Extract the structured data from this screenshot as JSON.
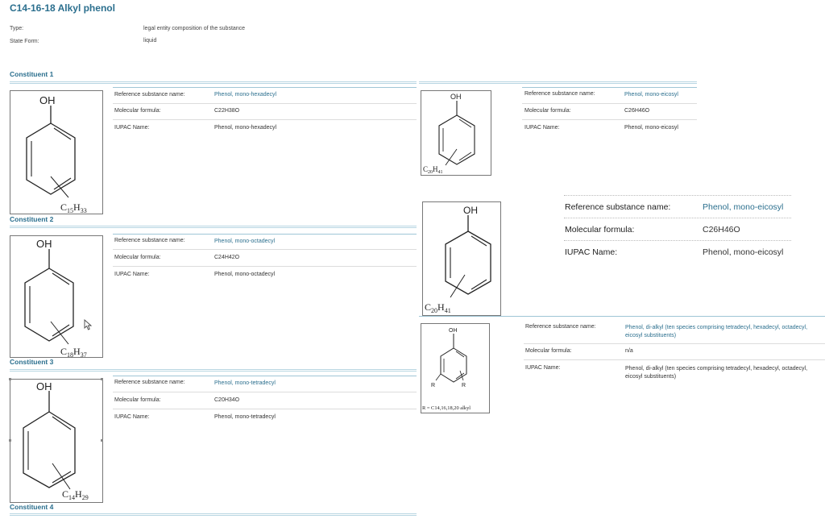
{
  "title": "C14-16-18 Alkyl phenol",
  "meta": {
    "type_label": "Type:",
    "type_value": "legal entity composition of the substance",
    "state_label": "State Form:",
    "state_value": "liquid"
  },
  "constituent_headings": [
    "Constituent 1",
    "Constituent 2",
    "Constituent 3",
    "Constituent 4"
  ],
  "labels": {
    "ref": "Reference substance name:",
    "formula": "Molecular formula:",
    "iupac": "IUPAC Name:"
  },
  "constituents": [
    {
      "ref": "Phenol, mono-hexadecyl",
      "formula": "C22H38O",
      "iupac": "Phenol, mono-hexadecyl"
    },
    {
      "ref": "Phenol, mono-octadecyl",
      "formula": "C24H42O",
      "iupac": "Phenol, mono-octadecyl"
    },
    {
      "ref": "Phenol, mono-tetradecyl",
      "formula": "C20H34O",
      "iupac": "Phenol, mono-tetradecyl"
    },
    {
      "ref": "Phenol, mono-eicosyl",
      "formula": "C26H46O",
      "iupac": "Phenol, mono-eicosyl"
    },
    {
      "ref": "Phenol, mono-eicosyl",
      "formula": "C26H46O",
      "iupac": "Phenol, mono-eicosyl"
    },
    {
      "ref": "Phenol, di-alkyl (ten species comprising tetradecyl, hexadecyl, octadecyl, eicosyl substituents)",
      "formula": "n/a",
      "iupac": "Phenol, di-alkyl (ten species comprising tetradecyl, hexadecyl, octadecyl, eicosyl substituents)"
    }
  ],
  "structures": {
    "s1": {
      "oh": "OH",
      "sub_c": "C",
      "sub_c_count": "15",
      "sub_h": "H",
      "sub_h_count": "33"
    },
    "s2": {
      "oh": "OH",
      "sub_c": "C",
      "sub_c_count": "18",
      "sub_h": "H",
      "sub_h_count": "37"
    },
    "s3": {
      "oh": "OH",
      "sub_c": "C",
      "sub_c_count": "14",
      "sub_h": "H",
      "sub_h_count": "29"
    },
    "s4": {
      "oh": "OH",
      "sub_c": "C",
      "sub_c_count": "20",
      "sub_h": "H",
      "sub_h_count": "41"
    },
    "s5": {
      "oh": "OH",
      "sub_c": "C",
      "sub_c_count": "20",
      "sub_h": "H",
      "sub_h_count": "41"
    },
    "s6": {
      "oh": "OH",
      "r1": "R",
      "r2": "R",
      "caption": "R = C14,16,18,20 alkyl"
    }
  }
}
